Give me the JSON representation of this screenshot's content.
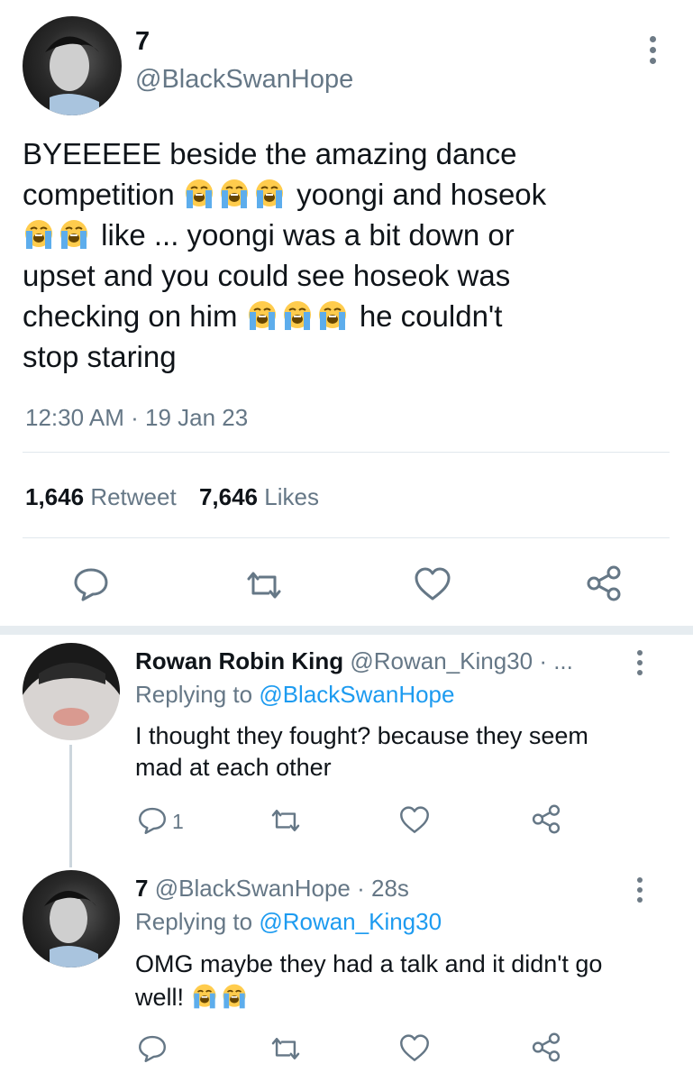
{
  "main_tweet": {
    "display_name": "7",
    "handle": "@BlackSwanHope",
    "line1": "BYEEEEE beside the amazing dance",
    "line2_a": "competition",
    "line2_b": "yoongi and hoseok",
    "line3_b": "like ... yoongi was a bit down or",
    "line4": "upset and you could see hoseok was",
    "line5_a": "checking on him",
    "line5_b": "he couldn't",
    "line6": "stop staring",
    "time": "12:30 AM",
    "date_sep": "·",
    "date": "19 Jan 23",
    "retweets_count": "1,646",
    "retweets_label": "Retweet",
    "likes_count": "7,646",
    "likes_label": "Likes",
    "emoji_icon": "loudly-crying-face-icon"
  },
  "reply1": {
    "display_name": "Rowan Robin King",
    "handle": "@Rowan_King30",
    "sep": "· ...",
    "replying_prefix": "Replying to",
    "replying_to": "@BlackSwanHope",
    "line1": "I thought they fought? because they seem",
    "line2": "mad at each other",
    "reply_count": "1"
  },
  "reply2": {
    "display_name": "7",
    "handle": "@BlackSwanHope",
    "sep": "·",
    "time": "28s",
    "replying_prefix": "Replying to",
    "replying_to": "@Rowan_King30",
    "line1": "OMG maybe they had a talk and it didn't go",
    "line2": "well!"
  },
  "colors": {
    "link": "#1d9bf0",
    "muted": "#657786",
    "text": "#0f1419",
    "divider": "#e1e8ed"
  }
}
